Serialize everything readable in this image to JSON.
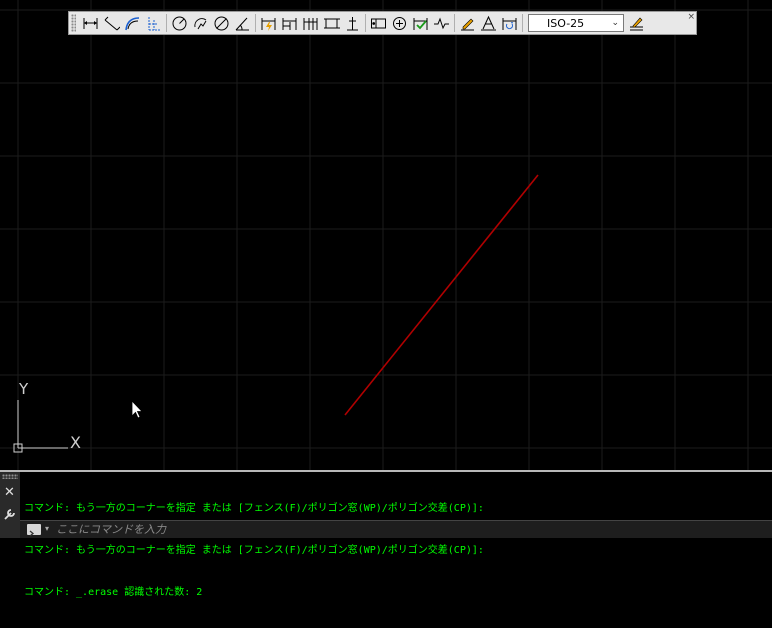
{
  "toolbar": {
    "buttons": [
      {
        "icon": "linear-dimension-icon"
      },
      {
        "icon": "aligned-dimension-icon"
      },
      {
        "icon": "arc-length-icon"
      },
      {
        "icon": "ordinate-dimension-icon"
      },
      {
        "icon": "radius-dimension-icon"
      },
      {
        "icon": "jogged-dimension-icon"
      },
      {
        "icon": "diameter-dimension-icon"
      },
      {
        "icon": "angular-dimension-icon"
      },
      {
        "icon": "quick-dimension-icon"
      },
      {
        "icon": "baseline-dimension-icon"
      },
      {
        "icon": "continue-dimension-icon"
      },
      {
        "icon": "dimension-space-icon"
      },
      {
        "icon": "dimension-break-icon"
      },
      {
        "icon": "tolerance-icon"
      },
      {
        "icon": "center-mark-icon"
      },
      {
        "icon": "inspect-icon"
      },
      {
        "icon": "jogged-linear-icon"
      },
      {
        "icon": "dimension-edit-icon"
      },
      {
        "icon": "dimension-text-edit-icon"
      },
      {
        "icon": "dimension-update-icon"
      }
    ],
    "dim_style": "ISO-25",
    "style_manager_icon": "dimension-style-icon",
    "close_glyph": "×"
  },
  "canvas": {
    "background": "#000000",
    "grid_color": "#1c1c1c",
    "line_color": "#b00000",
    "ucs": {
      "x_label": "X",
      "y_label": "Y"
    }
  },
  "command_window": {
    "close_glyph": "✕",
    "history": [
      "コマンド: もう一方のコーナーを指定 または [フェンス(F)/ポリゴン窓(WP)/ポリゴン交差(CP)]:",
      "コマンド: もう一方のコーナーを指定 または [フェンス(F)/ポリゴン窓(WP)/ポリゴン交差(CP)]:",
      "コマンド: _.erase 認識された数: 2"
    ],
    "input_value": "",
    "input_placeholder": "ここにコマンドを入力",
    "text_color": "#00ff00"
  }
}
